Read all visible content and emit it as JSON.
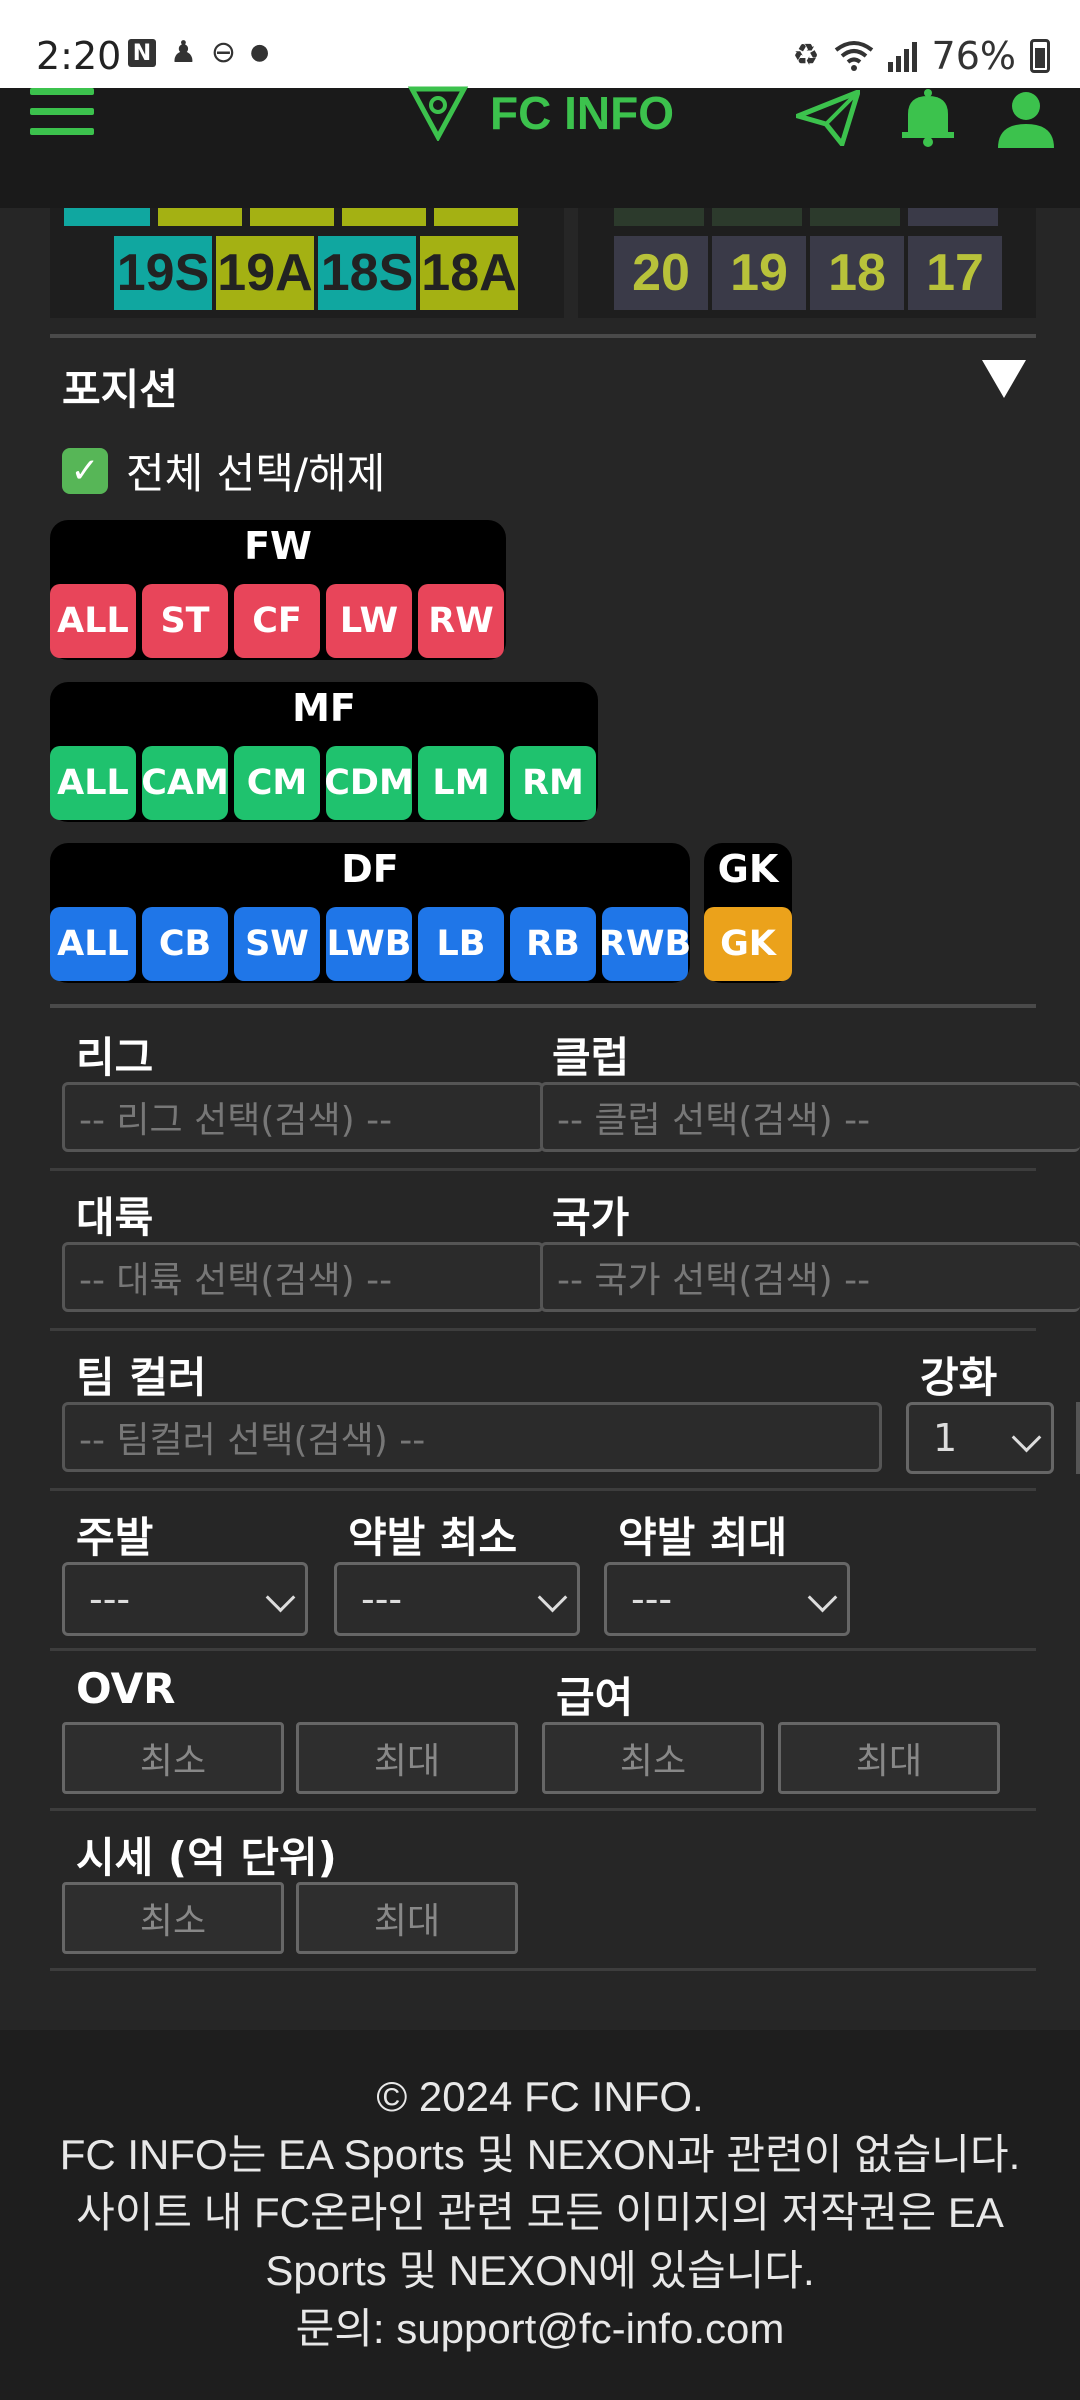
{
  "status_bar": {
    "time": "2:20",
    "battery": "76%"
  },
  "app": {
    "title": "FC INFO",
    "accent": "#3cc24d"
  },
  "season_tiles_left": [
    "19S",
    "19A",
    "18S",
    "18A"
  ],
  "season_tiles_right": [
    "20",
    "19",
    "18",
    "17"
  ],
  "position_section": {
    "title": "포지션",
    "select_all": "전체 선택/해제",
    "groups": {
      "fw": {
        "label": "FW",
        "buttons": [
          "ALL",
          "ST",
          "CF",
          "LW",
          "RW"
        ]
      },
      "mf": {
        "label": "MF",
        "buttons": [
          "ALL",
          "CAM",
          "CM",
          "CDM",
          "LM",
          "RM"
        ]
      },
      "df": {
        "label": "DF",
        "buttons": [
          "ALL",
          "CB",
          "SW",
          "LWB",
          "LB",
          "RB",
          "RWB"
        ]
      },
      "gk": {
        "label": "GK",
        "buttons": [
          "GK"
        ]
      }
    }
  },
  "filters": {
    "league": {
      "label": "리그",
      "placeholder": "-- 리그 선택(검색) --"
    },
    "club": {
      "label": "클럽",
      "placeholder": "-- 클럽 선택(검색) --"
    },
    "continent": {
      "label": "대륙",
      "placeholder": "-- 대륙 선택(검색) --"
    },
    "nation": {
      "label": "국가",
      "placeholder": "-- 국가 선택(검색) --"
    },
    "team_color": {
      "label": "팀 컬러",
      "placeholder": "-- 팀컬러 선택(검색) --"
    },
    "enhance": {
      "label": "강화",
      "value": "1"
    },
    "main_foot": {
      "label": "주발",
      "value": "---"
    },
    "weak_min": {
      "label": "약발 최소",
      "value": "---"
    },
    "weak_max": {
      "label": "약발 최대",
      "value": "---"
    },
    "ovr": {
      "label": "OVR",
      "min": "최소",
      "max": "최대"
    },
    "salary": {
      "label": "급여",
      "min": "최소",
      "max": "최대"
    },
    "price": {
      "label": "시세 (억 단위)",
      "min": "최소",
      "max": "최대"
    }
  },
  "footer": {
    "line1": "© 2024 FC INFO.",
    "line2": "FC INFO는 EA Sports 및 NEXON과 관련이 없습니다.",
    "line3": "사이트 내 FC온라인 관련 모든 이미지의 저작권은 EA",
    "line4": "Sports 및 NEXON에 있습니다.",
    "line5": "문의: support@fc-info.com"
  }
}
